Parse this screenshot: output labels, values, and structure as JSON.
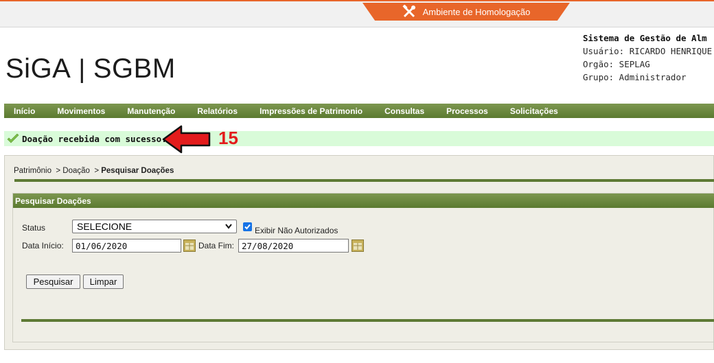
{
  "environment": {
    "label": "Ambiente de Homologação",
    "icon": "tools-icon",
    "color": "#e8662a"
  },
  "header": {
    "logo_text_a": "SiGA",
    "logo_sep": "|",
    "logo_text_b": "SGBM",
    "system_title": "Sistema de Gestão de Alm",
    "user": "Usuário: RICARDO HENRIQUE",
    "org": "Orgão: SEPLAG",
    "group": "Grupo: Administrador"
  },
  "menu": [
    "Início",
    "Movimentos",
    "Manutenção",
    "Relatórios",
    "Impressões de Patrimonio",
    "Consultas",
    "Processos",
    "Solicitações"
  ],
  "alert": {
    "message": "Doação recebida com sucesso.",
    "annotation_number": "15",
    "accent": "#e31c1c"
  },
  "breadcrumb": {
    "item1": "Patrimônio",
    "sep": ">",
    "item2": "Doação",
    "current": "Pesquisar Doações"
  },
  "search_panel": {
    "title": "Pesquisar Doações",
    "status_label": "Status",
    "status_value": "SELECIONE",
    "checkbox_label": "Exibir Não Autorizados",
    "checkbox_checked": true,
    "start_label": "Data Início:",
    "start_value": "01/06/2020",
    "end_label": "Data Fim:",
    "end_value": "27/08/2020",
    "search_button": "Pesquisar",
    "clear_button": "Limpar"
  },
  "colors": {
    "menu_green": "#5b7a30",
    "success_bg": "#d9fbd9",
    "panel_bg": "#efeee6"
  }
}
